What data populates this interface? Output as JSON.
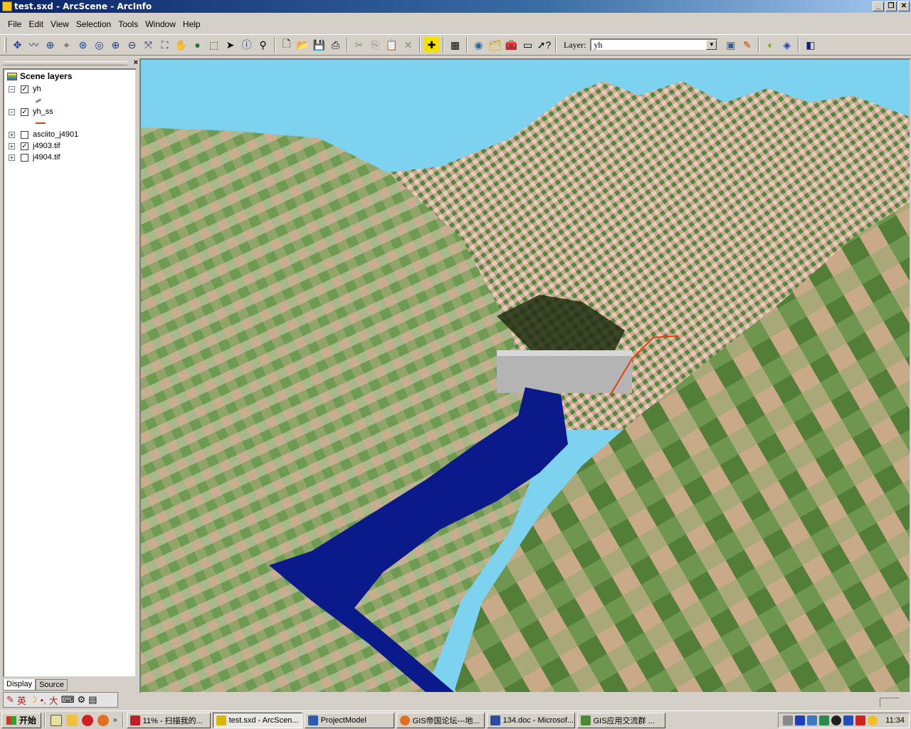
{
  "window": {
    "title": "test.sxd - ArcScene - ArcInfo"
  },
  "menu": [
    "File",
    "Edit",
    "View",
    "Selection",
    "Tools",
    "Window",
    "Help"
  ],
  "toolbar": {
    "navigate_tools": [
      "navigate-icon",
      "fly-icon",
      "zoom-target-icon",
      "center-target-icon",
      "zoom-to-target-icon",
      "set-observer-icon",
      "zoom-in-icon",
      "zoom-out-icon",
      "full-extent-icon",
      "zoom-layer-icon",
      "pan-icon",
      "globe-icon",
      "select-graphics-icon",
      "select-icon",
      "identify-icon",
      "find-icon"
    ],
    "layer_label": "Layer:",
    "layer_value": "yh"
  },
  "toc": {
    "title": "Scene layers",
    "layers": [
      {
        "name": "yh",
        "checked": true,
        "expanded": true
      },
      {
        "name": "yh_ss",
        "checked": true,
        "expanded": true
      },
      {
        "name": "asciito_j4901",
        "checked": false,
        "expanded": false
      },
      {
        "name": "j4903.tif",
        "checked": true,
        "expanded": false
      },
      {
        "name": "j4904.tif",
        "checked": false,
        "expanded": false
      }
    ],
    "tabs": [
      "Display",
      "Source"
    ]
  },
  "ime": {
    "mode": "英",
    "size": "大"
  },
  "taskbar": {
    "start_label": "开始",
    "tasks": [
      {
        "label": "11% - 扫描我的...",
        "color": "#c0202a"
      },
      {
        "label": "test.sxd - ArcScen...",
        "color": "#d8b800",
        "active": true
      },
      {
        "label": "ProjectModel",
        "color": "#2a5db0"
      },
      {
        "label": "GIS帝国论坛---地...",
        "color": "#e07020"
      },
      {
        "label": "134.doc - Microsof...",
        "color": "#2a4ea0"
      },
      {
        "label": "GIS应用交流群 ...",
        "color": "#4a8a30"
      }
    ],
    "clock": "11:34"
  },
  "colors": {
    "sky": "#7dd3ef",
    "water": "#0a1a8a",
    "terrain_light": "#d6b8a0",
    "terrain_green": "#6b9a4e",
    "terrain_dark": "#3e6e2c"
  }
}
